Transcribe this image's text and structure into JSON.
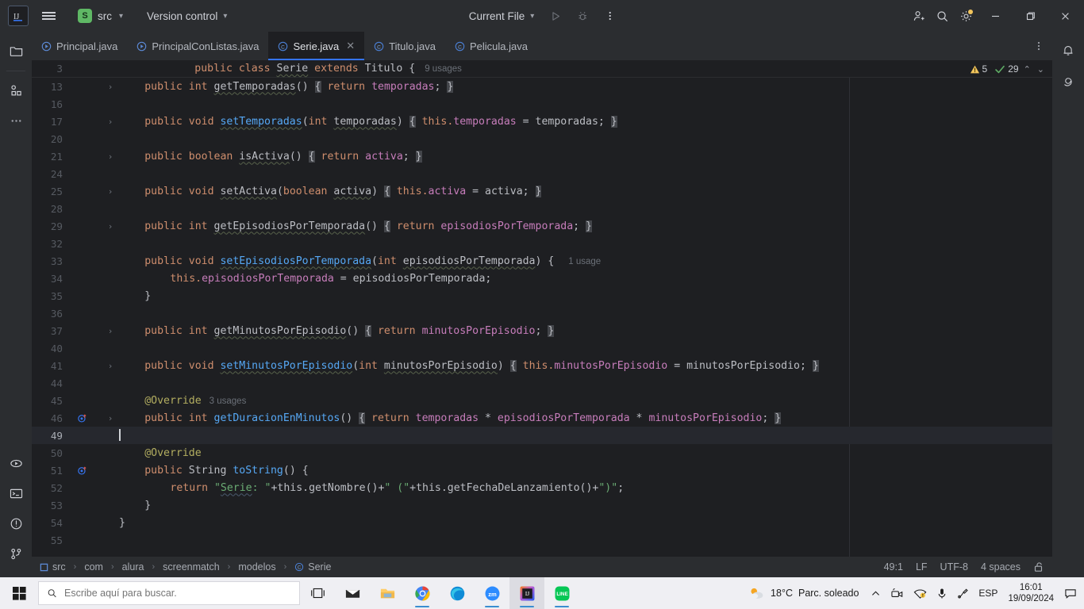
{
  "titlebar": {
    "logo_icon": "intellij-idea-logo",
    "menu_icon": "hamburger-menu-icon",
    "project_badge": "S",
    "project_name": "src",
    "vcs_label": "Version control",
    "run_config": "Current File",
    "run_icon": "run-icon",
    "debug_icon": "debug-icon",
    "more_icon": "more-vertical-icon",
    "share_icon": "add-user-icon",
    "search_icon": "search-icon",
    "settings_icon": "gear-icon",
    "minimize_icon": "minimize-icon",
    "maximize_icon": "maximize-icon",
    "close_icon": "close-icon"
  },
  "left_bar": {
    "top": [
      {
        "name": "project-tool-icon",
        "title": "Project"
      },
      {
        "name": "commit-tool-icon",
        "title": "Commit"
      },
      {
        "name": "more-tools-icon",
        "title": "More tool windows"
      }
    ],
    "bottom": [
      {
        "name": "run-tool-icon",
        "title": "Run"
      },
      {
        "name": "terminal-tool-icon",
        "title": "Terminal"
      },
      {
        "name": "problems-tool-icon",
        "title": "Problems"
      },
      {
        "name": "version-control-tool-icon",
        "title": "Version Control"
      }
    ]
  },
  "right_bar": [
    {
      "name": "notifications-icon",
      "title": "Notifications"
    },
    {
      "name": "ai-assistant-icon",
      "title": "AI Assistant"
    }
  ],
  "tabs": [
    {
      "label": "Principal.java",
      "icon": "java-runnable-class-icon",
      "active": false,
      "closable": false
    },
    {
      "label": "PrincipalConListas.java",
      "icon": "java-runnable-class-icon",
      "active": false,
      "closable": false
    },
    {
      "label": "Serie.java",
      "icon": "java-class-icon",
      "active": true,
      "closable": true
    },
    {
      "label": "Titulo.java",
      "icon": "java-class-icon",
      "active": false,
      "closable": false
    },
    {
      "label": "Pelicula.java",
      "icon": "java-class-icon",
      "active": false,
      "closable": false
    }
  ],
  "tabs_more_icon": "more-vertical-icon",
  "sticky_header": {
    "line_number": "3",
    "text": "public class Serie extends Titulo {",
    "usages": "9 usages"
  },
  "inspections": {
    "warning_icon": "warning-triangle-icon",
    "warning_count": "5",
    "ok_icon": "checkmark-icon",
    "ok_count": "29",
    "prev_icon": "chevron-up-icon",
    "next_icon": "chevron-down-icon"
  },
  "code_lines": [
    {
      "num": "13",
      "fold": true,
      "marker": "",
      "indent": 4,
      "current": false,
      "tokens": [
        {
          "t": "public ",
          "c": "k"
        },
        {
          "t": "int ",
          "c": "k"
        },
        {
          "t": "getTemporadas",
          "c": "mth wavy"
        },
        {
          "t": "() ",
          "c": "pl"
        },
        {
          "t": "{",
          "c": "brc"
        },
        {
          "t": " return ",
          "c": "k"
        },
        {
          "t": "temporadas",
          "c": "fld"
        },
        {
          "t": "; ",
          "c": "pl"
        },
        {
          "t": "}",
          "c": "brc"
        }
      ]
    },
    {
      "num": "16",
      "fold": false,
      "marker": "",
      "indent": 0,
      "current": false,
      "tokens": []
    },
    {
      "num": "17",
      "fold": true,
      "marker": "",
      "indent": 4,
      "current": false,
      "tokens": [
        {
          "t": "public ",
          "c": "k"
        },
        {
          "t": "void ",
          "c": "k"
        },
        {
          "t": "setTemporadas",
          "c": "mthb wavy"
        },
        {
          "t": "(",
          "c": "pl"
        },
        {
          "t": "int ",
          "c": "k"
        },
        {
          "t": "temporadas",
          "c": "pl wavy"
        },
        {
          "t": ") ",
          "c": "pl"
        },
        {
          "t": "{",
          "c": "brc"
        },
        {
          "t": " this.",
          "c": "k"
        },
        {
          "t": "temporadas",
          "c": "fld"
        },
        {
          "t": " = temporadas; ",
          "c": "pl"
        },
        {
          "t": "}",
          "c": "brc"
        }
      ]
    },
    {
      "num": "20",
      "fold": false,
      "marker": "",
      "indent": 0,
      "current": false,
      "tokens": []
    },
    {
      "num": "21",
      "fold": true,
      "marker": "",
      "indent": 4,
      "current": false,
      "tokens": [
        {
          "t": "public ",
          "c": "k"
        },
        {
          "t": "boolean ",
          "c": "k"
        },
        {
          "t": "isActiva",
          "c": "mth wavy"
        },
        {
          "t": "() ",
          "c": "pl"
        },
        {
          "t": "{",
          "c": "brc"
        },
        {
          "t": " return ",
          "c": "k"
        },
        {
          "t": "activa",
          "c": "fld"
        },
        {
          "t": "; ",
          "c": "pl"
        },
        {
          "t": "}",
          "c": "brc"
        }
      ]
    },
    {
      "num": "24",
      "fold": false,
      "marker": "",
      "indent": 0,
      "current": false,
      "tokens": []
    },
    {
      "num": "25",
      "fold": true,
      "marker": "",
      "indent": 4,
      "current": false,
      "tokens": [
        {
          "t": "public ",
          "c": "k"
        },
        {
          "t": "void ",
          "c": "k"
        },
        {
          "t": "setActiva",
          "c": "mth wavy"
        },
        {
          "t": "(",
          "c": "pl"
        },
        {
          "t": "boolean ",
          "c": "k"
        },
        {
          "t": "activa",
          "c": "pl wavy"
        },
        {
          "t": ") ",
          "c": "pl"
        },
        {
          "t": "{",
          "c": "brc"
        },
        {
          "t": " this.",
          "c": "k"
        },
        {
          "t": "activa",
          "c": "fld"
        },
        {
          "t": " = activa; ",
          "c": "pl"
        },
        {
          "t": "}",
          "c": "brc"
        }
      ]
    },
    {
      "num": "28",
      "fold": false,
      "marker": "",
      "indent": 0,
      "current": false,
      "tokens": []
    },
    {
      "num": "29",
      "fold": true,
      "marker": "",
      "indent": 4,
      "current": false,
      "tokens": [
        {
          "t": "public ",
          "c": "k"
        },
        {
          "t": "int ",
          "c": "k"
        },
        {
          "t": "getEpisodiosPorTemporada",
          "c": "mth wavy"
        },
        {
          "t": "() ",
          "c": "pl"
        },
        {
          "t": "{",
          "c": "brc"
        },
        {
          "t": " return ",
          "c": "k"
        },
        {
          "t": "episodiosPorTemporada",
          "c": "fld"
        },
        {
          "t": "; ",
          "c": "pl"
        },
        {
          "t": "}",
          "c": "brc"
        }
      ]
    },
    {
      "num": "32",
      "fold": false,
      "marker": "",
      "indent": 0,
      "current": false,
      "tokens": []
    },
    {
      "num": "33",
      "fold": false,
      "marker": "",
      "indent": 4,
      "current": false,
      "usages": "1 usage",
      "tokens": [
        {
          "t": "public ",
          "c": "k"
        },
        {
          "t": "void ",
          "c": "k"
        },
        {
          "t": "setEpisodiosPorTemporada",
          "c": "mthb wavy"
        },
        {
          "t": "(",
          "c": "pl"
        },
        {
          "t": "int ",
          "c": "k"
        },
        {
          "t": "episodiosPorTemporada",
          "c": "pl wavy"
        },
        {
          "t": ") { ",
          "c": "pl"
        }
      ]
    },
    {
      "num": "34",
      "fold": false,
      "marker": "",
      "indent": 8,
      "current": false,
      "tokens": [
        {
          "t": "this.",
          "c": "k"
        },
        {
          "t": "episodiosPorTemporada",
          "c": "fld"
        },
        {
          "t": " = episodiosPorTemporada;",
          "c": "pl"
        }
      ]
    },
    {
      "num": "35",
      "fold": false,
      "marker": "",
      "indent": 4,
      "current": false,
      "tokens": [
        {
          "t": "}",
          "c": "pl"
        }
      ]
    },
    {
      "num": "36",
      "fold": false,
      "marker": "",
      "indent": 0,
      "current": false,
      "tokens": []
    },
    {
      "num": "37",
      "fold": true,
      "marker": "",
      "indent": 4,
      "current": false,
      "tokens": [
        {
          "t": "public ",
          "c": "k"
        },
        {
          "t": "int ",
          "c": "k"
        },
        {
          "t": "getMinutosPorEpisodio",
          "c": "mth wavy"
        },
        {
          "t": "() ",
          "c": "pl"
        },
        {
          "t": "{",
          "c": "brc"
        },
        {
          "t": " return ",
          "c": "k"
        },
        {
          "t": "minutosPorEpisodio",
          "c": "fld"
        },
        {
          "t": "; ",
          "c": "pl"
        },
        {
          "t": "}",
          "c": "brc"
        }
      ]
    },
    {
      "num": "40",
      "fold": false,
      "marker": "",
      "indent": 0,
      "current": false,
      "tokens": []
    },
    {
      "num": "41",
      "fold": true,
      "marker": "",
      "indent": 4,
      "current": false,
      "tokens": [
        {
          "t": "public ",
          "c": "k"
        },
        {
          "t": "void ",
          "c": "k"
        },
        {
          "t": "setMinutosPorEpisodio",
          "c": "mthb wavy"
        },
        {
          "t": "(",
          "c": "pl"
        },
        {
          "t": "int ",
          "c": "k"
        },
        {
          "t": "minutosPorEpisodio",
          "c": "pl wavy"
        },
        {
          "t": ") ",
          "c": "pl"
        },
        {
          "t": "{",
          "c": "brc"
        },
        {
          "t": " this.",
          "c": "k"
        },
        {
          "t": "minutosPorEpisodio",
          "c": "fld"
        },
        {
          "t": " = minutosPorEpisodio; ",
          "c": "pl"
        },
        {
          "t": "}",
          "c": "brc"
        }
      ]
    },
    {
      "num": "44",
      "fold": false,
      "marker": "",
      "indent": 0,
      "current": false,
      "tokens": []
    },
    {
      "num": "45",
      "fold": false,
      "marker": "",
      "indent": 4,
      "current": false,
      "usages": "3 usages",
      "tokens": [
        {
          "t": "@Override",
          "c": "ann"
        }
      ]
    },
    {
      "num": "46",
      "fold": true,
      "marker": "override",
      "indent": 4,
      "current": false,
      "tokens": [
        {
          "t": "public ",
          "c": "k"
        },
        {
          "t": "int ",
          "c": "k"
        },
        {
          "t": "getDuracionEnMinutos",
          "c": "mthb"
        },
        {
          "t": "() ",
          "c": "pl"
        },
        {
          "t": "{",
          "c": "brc"
        },
        {
          "t": " return ",
          "c": "k"
        },
        {
          "t": "temporadas",
          "c": "fld"
        },
        {
          "t": " * ",
          "c": "pl"
        },
        {
          "t": "episodiosPorTemporada",
          "c": "fld"
        },
        {
          "t": " * ",
          "c": "pl"
        },
        {
          "t": "minutosPorEpisodio",
          "c": "fld"
        },
        {
          "t": "; ",
          "c": "pl"
        },
        {
          "t": "}",
          "c": "brc"
        }
      ]
    },
    {
      "num": "49",
      "fold": false,
      "marker": "",
      "indent": 0,
      "current": true,
      "caret": true,
      "tokens": []
    },
    {
      "num": "50",
      "fold": false,
      "marker": "",
      "indent": 4,
      "current": false,
      "tokens": [
        {
          "t": "@Override",
          "c": "ann"
        }
      ]
    },
    {
      "num": "51",
      "fold": false,
      "marker": "override",
      "indent": 4,
      "current": false,
      "tokens": [
        {
          "t": "public ",
          "c": "k"
        },
        {
          "t": "String ",
          "c": "pl"
        },
        {
          "t": "toString",
          "c": "mthb"
        },
        {
          "t": "() {",
          "c": "pl"
        }
      ]
    },
    {
      "num": "52",
      "fold": false,
      "marker": "",
      "indent": 8,
      "current": false,
      "tokens": [
        {
          "t": "return ",
          "c": "k"
        },
        {
          "t": "\"",
          "c": "str"
        },
        {
          "t": "Serie",
          "c": "str wavyg"
        },
        {
          "t": ": \"",
          "c": "str"
        },
        {
          "t": "+this.",
          "c": "pl"
        },
        {
          "t": "getNombre",
          "c": "pl"
        },
        {
          "t": "()+",
          "c": "pl"
        },
        {
          "t": "\" (\"",
          "c": "str"
        },
        {
          "t": "+this.",
          "c": "pl"
        },
        {
          "t": "getFechaDeLanzamiento",
          "c": "pl"
        },
        {
          "t": "()+",
          "c": "pl"
        },
        {
          "t": "\")\"",
          "c": "str"
        },
        {
          "t": ";",
          "c": "pl"
        }
      ]
    },
    {
      "num": "53",
      "fold": false,
      "marker": "",
      "indent": 4,
      "current": false,
      "tokens": [
        {
          "t": "}",
          "c": "pl"
        }
      ]
    },
    {
      "num": "54",
      "fold": false,
      "marker": "",
      "indent": 0,
      "current": false,
      "tokens": [
        {
          "t": "}",
          "c": "pl"
        }
      ]
    },
    {
      "num": "55",
      "fold": false,
      "marker": "",
      "indent": 0,
      "current": false,
      "tokens": []
    }
  ],
  "breadcrumb": [
    {
      "label": "src",
      "icon": "module-icon"
    },
    {
      "label": "com",
      "icon": ""
    },
    {
      "label": "alura",
      "icon": ""
    },
    {
      "label": "screenmatch",
      "icon": ""
    },
    {
      "label": "modelos",
      "icon": ""
    },
    {
      "label": "Serie",
      "icon": "java-class-icon"
    }
  ],
  "status_bar": {
    "caret_position": "49:1",
    "line_separator": "LF",
    "encoding": "UTF-8",
    "indent": "4 spaces",
    "lock_icon": "unlocked-icon"
  },
  "taskbar": {
    "start_icon": "windows-start-icon",
    "search_icon": "search-icon",
    "search_placeholder": "Escribe aquí para buscar.",
    "search_value": "",
    "task_view_icon": "task-view-icon",
    "apps": [
      {
        "name": "mail-app-icon",
        "label": "Mail",
        "active": false,
        "running": false
      },
      {
        "name": "file-explorer-icon",
        "label": "File Explorer",
        "active": false,
        "running": false
      },
      {
        "name": "chrome-icon",
        "label": "Google Chrome",
        "active": false,
        "running": true
      },
      {
        "name": "edge-icon",
        "label": "Microsoft Edge",
        "active": false,
        "running": false
      },
      {
        "name": "zoom-icon",
        "label": "Zoom",
        "active": false,
        "running": true
      },
      {
        "name": "intellij-idea-icon",
        "label": "IntelliJ IDEA",
        "active": true,
        "running": true
      },
      {
        "name": "line-icon",
        "label": "LINE",
        "active": false,
        "running": true
      }
    ],
    "tray": {
      "weather_icon": "weather-partly-sunny-icon",
      "temperature": "18°C",
      "condition": "Parc. soleado",
      "overflow_icon": "chevron-up-icon",
      "camera_icon": "camera-icon",
      "network_icon": "network-warning-icon",
      "mic_icon": "microphone-icon",
      "pen_icon": "pen-icon",
      "language": "ESP",
      "time": "16:01",
      "date": "19/09/2024",
      "notifications_icon": "notification-icon"
    }
  }
}
